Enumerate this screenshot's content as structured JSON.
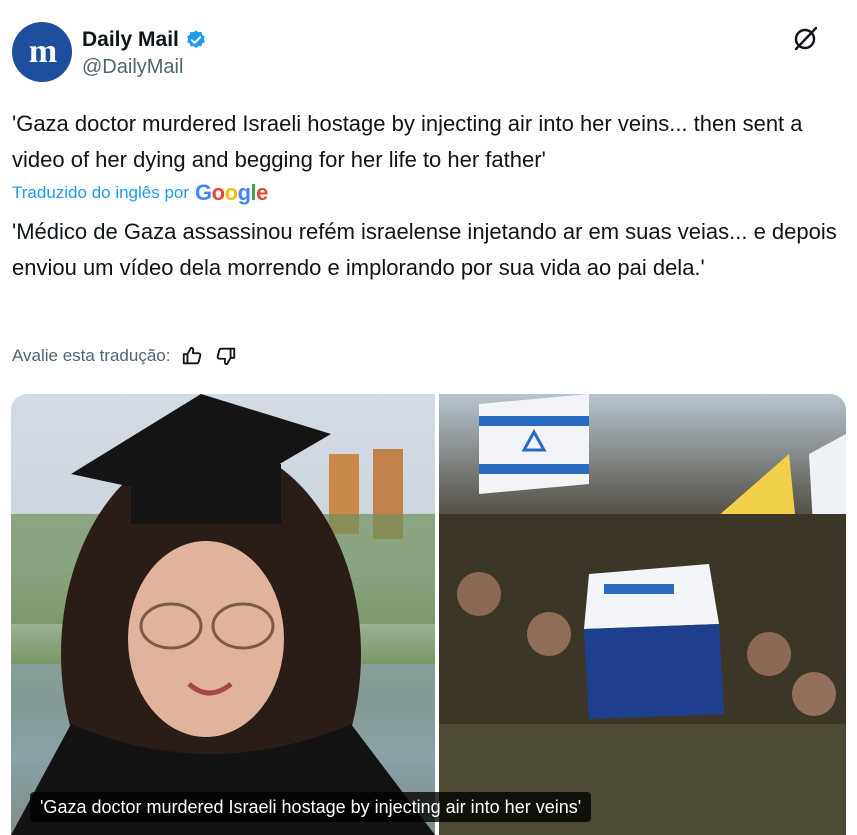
{
  "author": {
    "name": "Daily Mail",
    "handle": "@DailyMail",
    "avatar_letters": "m",
    "verified_color": "#1d9bf0"
  },
  "tweet": {
    "text": "'Gaza doctor murdered Israeli hostage by injecting air into her veins... then sent a video of her dying and begging for her life to her father'",
    "translated_by": "Traduzido do inglês por",
    "translator_brand": "Google",
    "translation": "'Médico de Gaza assassinou refém israelense injetando ar em suas veias... e depois enviou um vídeo dela morrendo e implorando por sua vida ao pai dela.'",
    "rate_label": "Avalie esta tradução:"
  },
  "media": {
    "caption": "'Gaza doctor murdered Israeli hostage by injecting air into her veins'"
  },
  "icons": {
    "grok": "grok-icon",
    "thumbs_up": "thumbs-up-icon",
    "thumbs_down": "thumbs-down-icon",
    "verified": "verified-badge-icon"
  },
  "colors": {
    "accent": "#1d9bf0",
    "avatar_bg": "#1d4f9c",
    "text_primary": "#0f1419",
    "text_secondary": "#536471"
  }
}
